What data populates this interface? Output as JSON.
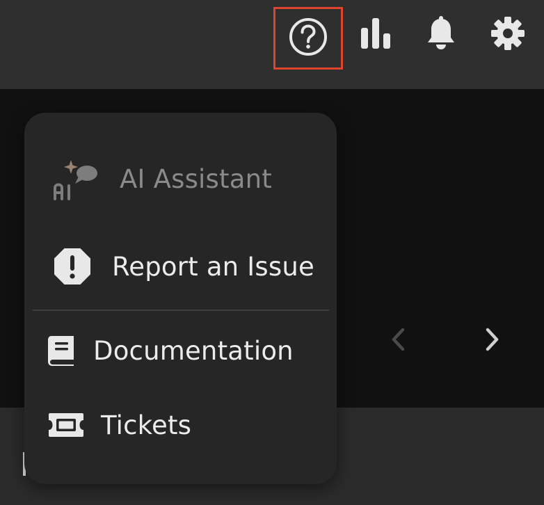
{
  "topbar": {
    "help_icon": "help-circle-icon",
    "stats_icon": "bar-chart-icon",
    "notifications_icon": "bell-icon",
    "settings_icon": "gear-icon",
    "highlight_color": "#e0442e"
  },
  "help_menu": {
    "items": [
      {
        "label": "AI Assistant",
        "icon": "ai-assistant-icon",
        "enabled": false
      },
      {
        "label": "Report an Issue",
        "icon": "alert-octagon-icon",
        "enabled": true
      },
      {
        "label": "Documentation",
        "icon": "book-icon",
        "enabled": true
      },
      {
        "label": "Tickets",
        "icon": "ticket-icon",
        "enabled": true
      }
    ]
  },
  "carousel": {
    "prev_icon": "chevron-left-icon",
    "next_icon": "chevron-right-icon"
  }
}
